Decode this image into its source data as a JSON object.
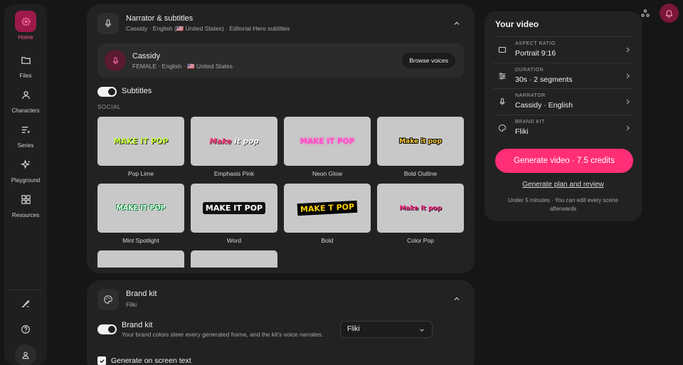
{
  "sidebar": {
    "items": [
      {
        "label": "Home",
        "icon": "gear-flower-icon",
        "active": true
      },
      {
        "label": "Files",
        "icon": "folder-icon"
      },
      {
        "label": "Characters",
        "icon": "user-icon"
      },
      {
        "label": "Series",
        "icon": "list-icon"
      },
      {
        "label": "Playground",
        "icon": "sparkle-icon"
      },
      {
        "label": "Resources",
        "icon": "grid-icon"
      }
    ],
    "bottom": [
      "brush-icon",
      "help-icon",
      "account-icon"
    ]
  },
  "narrator_card": {
    "title": "Narrator & subtitles",
    "subtitle": "Cassidy · English (🇺🇸 United States) · Editorial Hero subtitles",
    "voice": {
      "name": "Cassidy",
      "meta": "FEMALE · English · 🇺🇸 United States",
      "browse_label": "Browse voices"
    },
    "subtitles_label": "Subtitles",
    "subtitles_on": true,
    "section": "SOCIAL",
    "styles": [
      {
        "name": "Pop Lime",
        "preview": "MAKE IT POP"
      },
      {
        "name": "Emphasis Pink",
        "preview_a": "Make",
        "preview_b": " it pop"
      },
      {
        "name": "Neon Glow",
        "preview": "MAKE IT POP"
      },
      {
        "name": "Bold Outline",
        "preview": "Make it pop"
      },
      {
        "name": "Mint Spotlight",
        "preview": "MAKE IT POP"
      },
      {
        "name": "Word",
        "preview": "MAKE IT POP"
      },
      {
        "name": "Bold",
        "preview": "MAKE T POP"
      },
      {
        "name": "Color Pop",
        "preview": "Make it pop"
      }
    ]
  },
  "brand_card": {
    "title": "Brand kit",
    "subtitle": "Fliki",
    "toggle_label": "Brand kit",
    "toggle_desc": "Your brand colors steer every generated frame, and the kit's voice narrates.",
    "select_value": "Fliki",
    "checkbox_label": "Generate on screen text"
  },
  "video_panel": {
    "title": "Your video",
    "rows": [
      {
        "caption": "ASPECT RATIO",
        "value": "Portrait 9:16",
        "icon": "aspect-ratio-icon"
      },
      {
        "caption": "DURATION",
        "value": "30s · 2 segments",
        "icon": "sliders-icon"
      },
      {
        "caption": "NARRATOR",
        "value": "Cassidy · English",
        "icon": "mic-icon"
      },
      {
        "caption": "BRAND KIT",
        "value": "Fliki",
        "icon": "palette-icon"
      }
    ],
    "generate_label": "Generate video · 7.5 credits",
    "plan_link": "Generate plan and review",
    "note": "Under 5 minutes · You can edit every scene afterwards"
  },
  "colors": {
    "accent": "#ff2e77",
    "panel": "#222222",
    "bg": "#161616"
  }
}
